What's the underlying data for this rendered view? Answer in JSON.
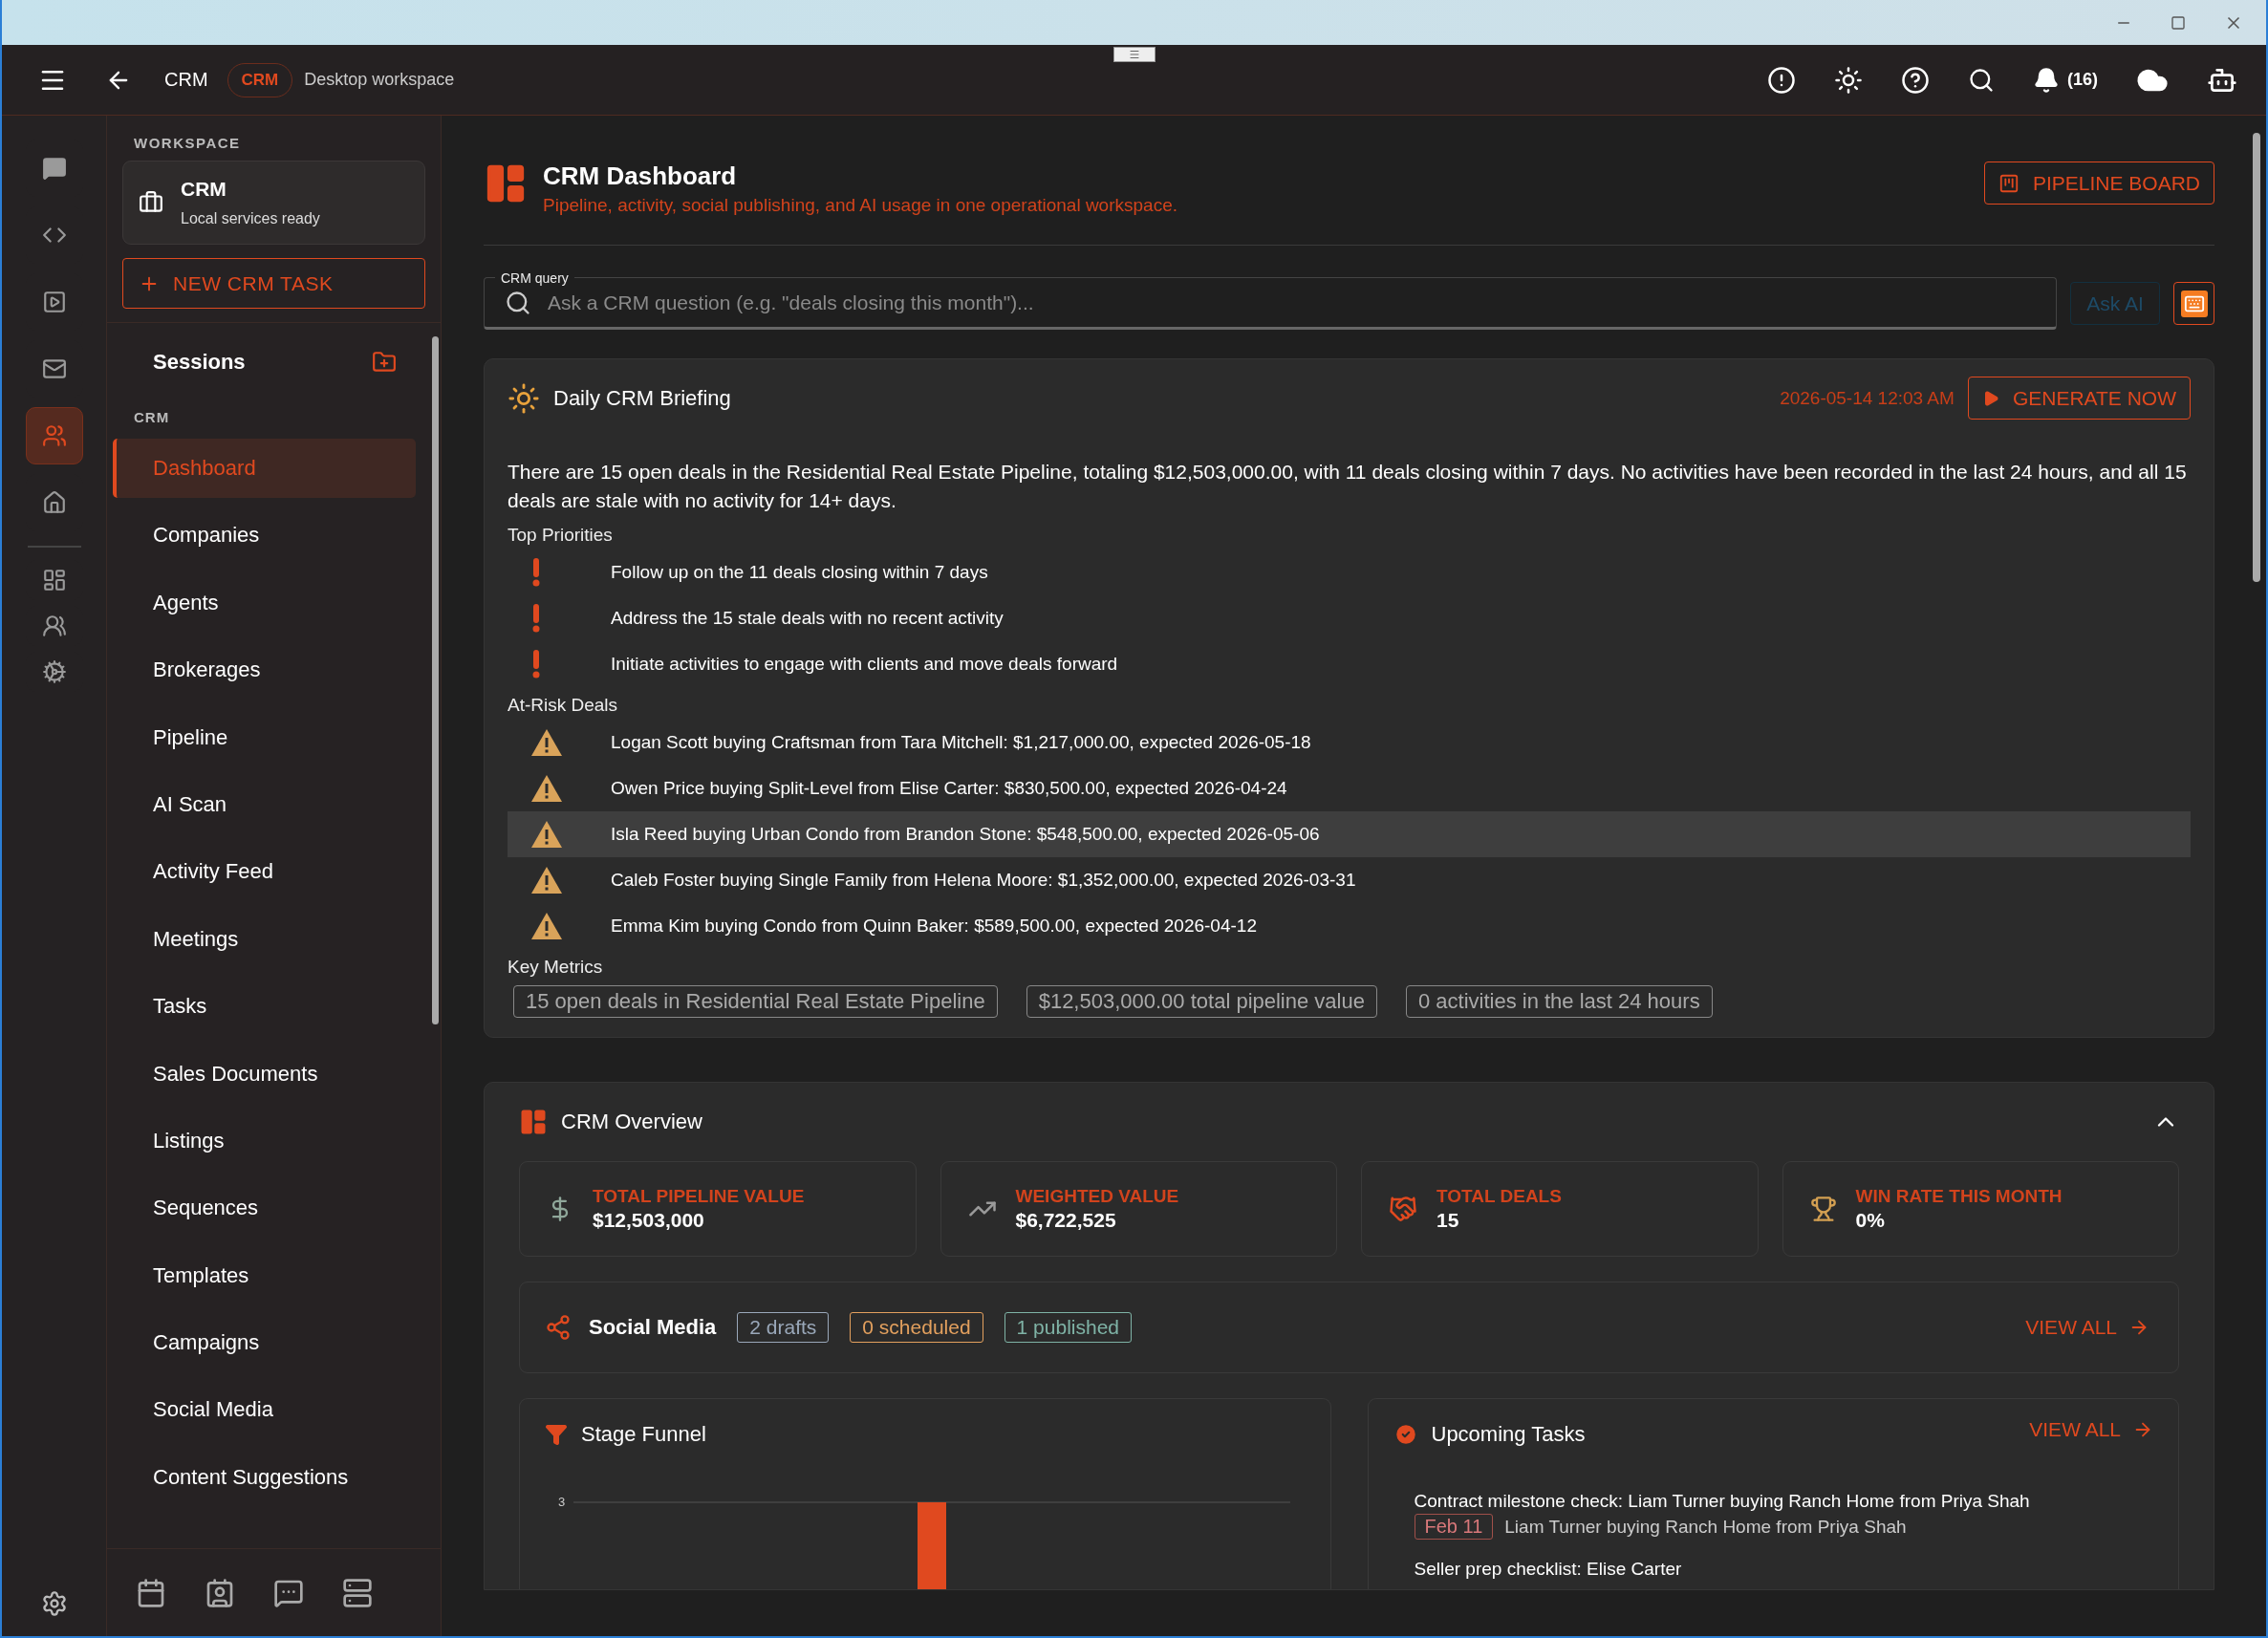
{
  "app_bar": {
    "breadcrumb": "CRM",
    "chip": "CRM",
    "subtitle": "Desktop workspace",
    "notification_count": "(16)"
  },
  "rail": {
    "items": [
      {
        "kind": "chat",
        "selected": false
      },
      {
        "kind": "code",
        "selected": false
      },
      {
        "kind": "media",
        "selected": false
      },
      {
        "kind": "mail",
        "selected": false
      },
      {
        "kind": "people",
        "selected": true
      },
      {
        "kind": "home",
        "selected": false
      }
    ],
    "tools": [
      {
        "kind": "dashboard",
        "selected": false
      },
      {
        "kind": "team",
        "selected": false
      },
      {
        "kind": "gears",
        "selected": false
      }
    ]
  },
  "sidebar": {
    "section_label": "WORKSPACE",
    "workspace": {
      "name": "CRM",
      "status": "Local services ready"
    },
    "new_task_button": "NEW CRM TASK",
    "sessions_label": "Sessions",
    "group_label": "CRM",
    "items": [
      {
        "label": "Dashboard",
        "selected": true
      },
      {
        "label": "Companies",
        "selected": false
      },
      {
        "label": "Agents",
        "selected": false
      },
      {
        "label": "Brokerages",
        "selected": false
      },
      {
        "label": "Pipeline",
        "selected": false
      },
      {
        "label": "AI Scan",
        "selected": false
      },
      {
        "label": "Activity Feed",
        "selected": false
      },
      {
        "label": "Meetings",
        "selected": false
      },
      {
        "label": "Tasks",
        "selected": false
      },
      {
        "label": "Sales Documents",
        "selected": false
      },
      {
        "label": "Listings",
        "selected": false
      },
      {
        "label": "Sequences",
        "selected": false
      },
      {
        "label": "Templates",
        "selected": false
      },
      {
        "label": "Campaigns",
        "selected": false
      },
      {
        "label": "Social Media",
        "selected": false
      },
      {
        "label": "Content Suggestions",
        "selected": false
      }
    ]
  },
  "header": {
    "title": "CRM Dashboard",
    "subtitle": "Pipeline, activity, social publishing, and AI usage in one operational workspace.",
    "pipeline_button": "PIPELINE BOARD"
  },
  "query": {
    "label": "CRM query",
    "placeholder": "Ask a CRM question (e.g. \"deals closing this month\")...",
    "ask_button": "Ask AI",
    "ask_disabled": true
  },
  "briefing": {
    "title": "Daily CRM Briefing",
    "timestamp": "2026-05-14 12:03 AM",
    "generate_button": "GENERATE NOW",
    "summary": "There are 15 open deals in the Residential Real Estate Pipeline, totaling $12,503,000.00, with 11 deals closing within 7 days. No activities have been recorded in the last 24 hours, and all 15 deals are stale with no activity for 14+ days.",
    "priorities_label": "Top Priorities",
    "priorities": [
      "Follow up on the 11 deals closing within 7 days",
      "Address the 15 stale deals with no recent activity",
      "Initiate activities to engage with clients and move deals forward"
    ],
    "at_risk_label": "At-Risk Deals",
    "at_risk": [
      {
        "text": "Logan Scott buying Craftsman from Tara Mitchell: $1,217,000.00, expected 2026-05-18",
        "selected": false
      },
      {
        "text": "Owen Price buying Split-Level from Elise Carter: $830,500.00, expected 2026-04-24",
        "selected": false
      },
      {
        "text": "Isla Reed buying Urban Condo from Brandon Stone: $548,500.00, expected 2026-05-06",
        "selected": true
      },
      {
        "text": "Caleb Foster buying Single Family from Helena Moore: $1,352,000.00, expected 2026-03-31",
        "selected": false
      },
      {
        "text": "Emma Kim buying Condo from Quinn Baker: $589,500.00, expected 2026-04-12",
        "selected": false
      }
    ],
    "metrics_label": "Key Metrics",
    "metrics": [
      "15 open deals in Residential Real Estate Pipeline",
      "$12,503,000.00 total pipeline value",
      "0 activities in the last 24 hours"
    ]
  },
  "overview": {
    "title": "CRM Overview",
    "expanded": true,
    "stats": [
      {
        "kind": "dollar",
        "label": "TOTAL PIPELINE VALUE",
        "value": "$12,503,000"
      },
      {
        "kind": "trend",
        "label": "WEIGHTED VALUE",
        "value": "$6,722,525"
      },
      {
        "kind": "handshake",
        "label": "TOTAL DEALS",
        "value": "15"
      },
      {
        "kind": "trophy",
        "label": "WIN RATE THIS MONTH",
        "value": "0%"
      }
    ],
    "social": {
      "title": "Social Media",
      "view_all": "VIEW ALL",
      "chips": [
        {
          "text": "2 drafts",
          "color": "#9aa8ba"
        },
        {
          "text": "0 scheduled",
          "color": "#e3a05e"
        },
        {
          "text": "1 published",
          "color": "#7fb3a6"
        }
      ]
    },
    "funnel": {
      "title": "Stage Funnel",
      "tick": "3"
    },
    "tasks": {
      "title": "Upcoming Tasks",
      "view_all": "VIEW ALL",
      "items": [
        {
          "title": "Contract milestone check: Liam Turner buying Ranch Home from Priya Shah",
          "date": "Feb 11",
          "deal": "Liam Turner buying Ranch Home from Priya Shah"
        },
        {
          "title": "Seller prep checklist: Elise Carter"
        }
      ]
    }
  }
}
